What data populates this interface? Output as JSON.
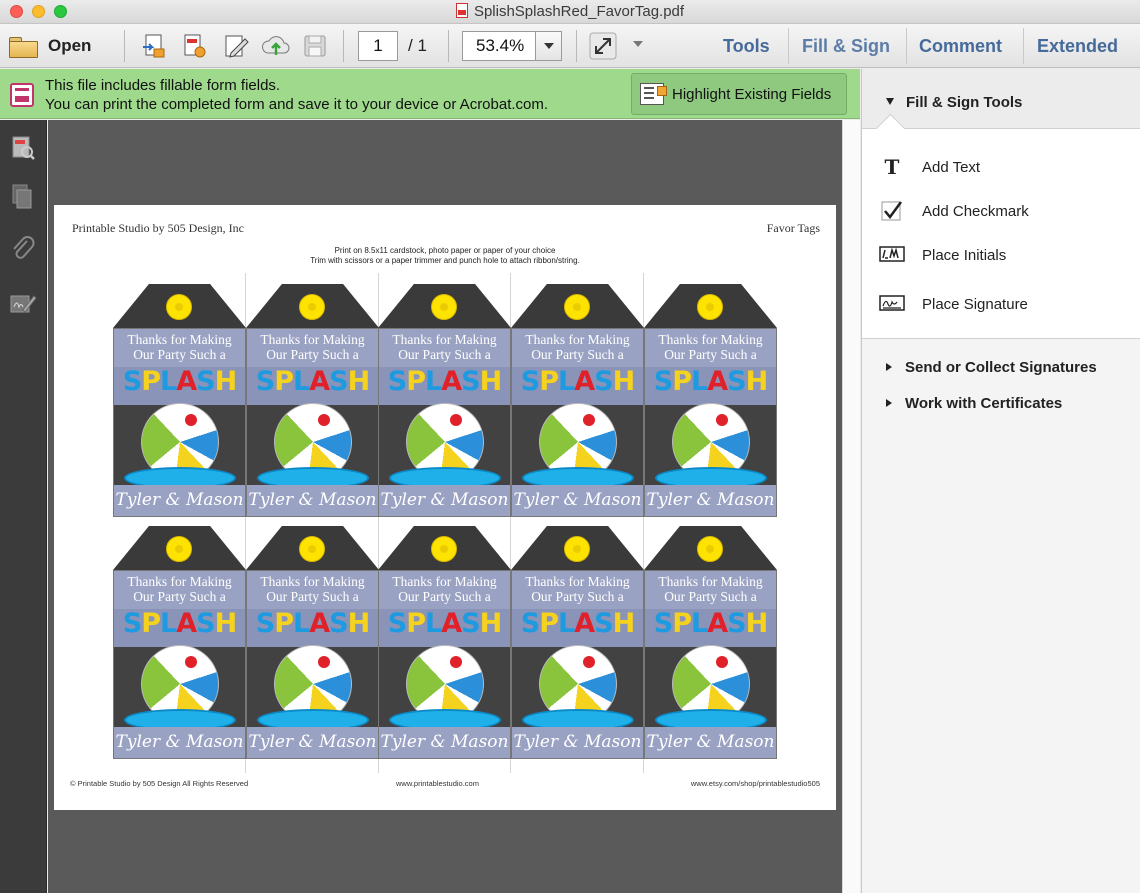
{
  "window": {
    "title": "SplishSplashRed_FavorTag.pdf"
  },
  "toolbar": {
    "open_label": "Open",
    "page_current": "1",
    "page_total": "/ 1",
    "zoom": "53.4%",
    "tabs": [
      "Tools",
      "Fill & Sign",
      "Comment",
      "Extended"
    ]
  },
  "infobar": {
    "line1": "This file includes fillable form fields.",
    "line2": "You can print the completed form and save it to your device or Acrobat.com.",
    "highlight_button": "Highlight Existing Fields"
  },
  "document": {
    "header_left": "Printable Studio by 505 Design, Inc",
    "header_right": "Favor Tags",
    "instruction1": "Print on 8.5x11 cardstock, photo paper or paper of your choice",
    "instruction2": "Trim with scissors or a paper trimmer and punch hole to attach ribbon/string.",
    "footer_left": "© Printable Studio by 505 Design All Rights Reserved",
    "footer_center": "www.printablestudio.com",
    "footer_right": "www.etsy.com/shop/printablestudio505",
    "tag": {
      "line1": "Thanks for Making",
      "line2": "Our Party Such a",
      "splash_letters": [
        {
          "ch": "S",
          "color": "#1e9be0"
        },
        {
          "ch": "P",
          "color": "#f5d21e"
        },
        {
          "ch": "L",
          "color": "#1e9be0"
        },
        {
          "ch": "A",
          "color": "#e0212a"
        },
        {
          "ch": "S",
          "color": "#1e9be0"
        },
        {
          "ch": "H",
          "color": "#f5d21e"
        }
      ],
      "name": "Tyler & Mason"
    }
  },
  "panel": {
    "section_title": "Fill & Sign Tools",
    "tools": [
      {
        "icon": "text-T-icon",
        "label": "Add Text"
      },
      {
        "icon": "checkmark-icon",
        "label": "Add Checkmark"
      },
      {
        "icon": "initials-icon",
        "label": "Place Initials"
      },
      {
        "icon": "signature-icon",
        "label": "Place Signature"
      }
    ],
    "subsections": [
      "Send or Collect Signatures",
      "Work with Certificates"
    ]
  },
  "colors": {
    "infobar_bg": "#9ed98c",
    "accent_link": "#466a99",
    "tag_band": "#9aa2c3"
  }
}
